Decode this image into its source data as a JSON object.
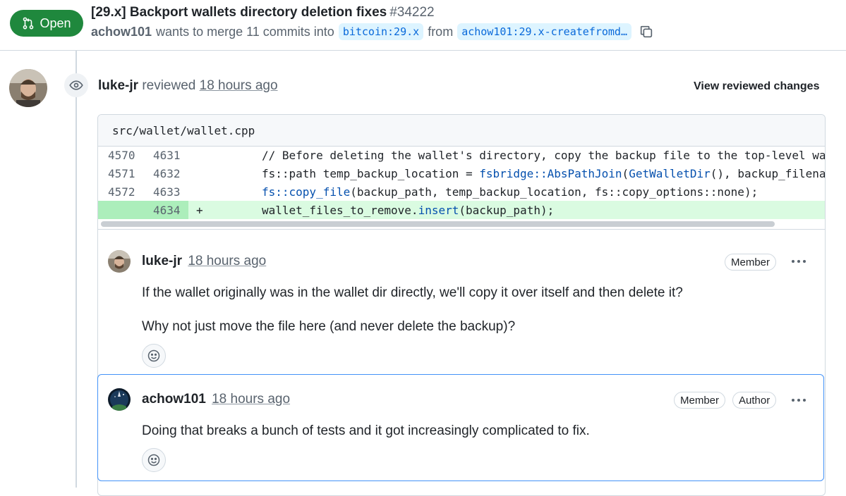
{
  "header": {
    "state": "Open",
    "title": "[29.x] Backport wallets directory deletion fixes",
    "number": "#34222",
    "author": "achow101",
    "merge_text": "wants to merge 11 commits into",
    "base_branch": "bitcoin:29.x",
    "from_text": "from",
    "head_branch": "achow101:29.x-createfromd…"
  },
  "review": {
    "reviewer": "luke-jr",
    "action": "reviewed",
    "time": "18 hours ago",
    "view_changes": "View reviewed changes",
    "file": "src/wallet/wallet.cpp"
  },
  "diff_lines": [
    {
      "old": "4570",
      "new": "4631",
      "sign": "",
      "code": "        // Before deleting the wallet's directory, copy the backup file to the top-level wallet dir"
    },
    {
      "old": "4571",
      "new": "4632",
      "sign": "",
      "code": "        fs::path temp_backup_location = fsbridge::AbsPathJoin(GetWalletDir(), backup_filename);"
    },
    {
      "old": "4572",
      "new": "4633",
      "sign": "",
      "code": "        fs::copy_file(backup_path, temp_backup_location, fs::copy_options::none);"
    },
    {
      "old": "",
      "new": "4634",
      "sign": "+",
      "code": "        wallet_files_to_remove.insert(backup_path);"
    }
  ],
  "comments": [
    {
      "author": "luke-jr",
      "time": "18 hours ago",
      "labels": [
        "Member"
      ],
      "paragraphs": [
        "If the wallet originally was in the wallet dir directly, we'll copy it over itself and then delete it?",
        "Why not just move the file here (and never delete the backup)?"
      ]
    },
    {
      "author": "achow101",
      "time": "18 hours ago",
      "labels": [
        "Member",
        "Author"
      ],
      "paragraphs": [
        "Doing that breaks a bunch of tests and it got increasingly complicated to fix."
      ]
    }
  ],
  "colors": {
    "open_green": "#1f883d",
    "link_blue": "#0969da",
    "added_line": "#dafbe1",
    "focus_border": "#4493f8"
  }
}
